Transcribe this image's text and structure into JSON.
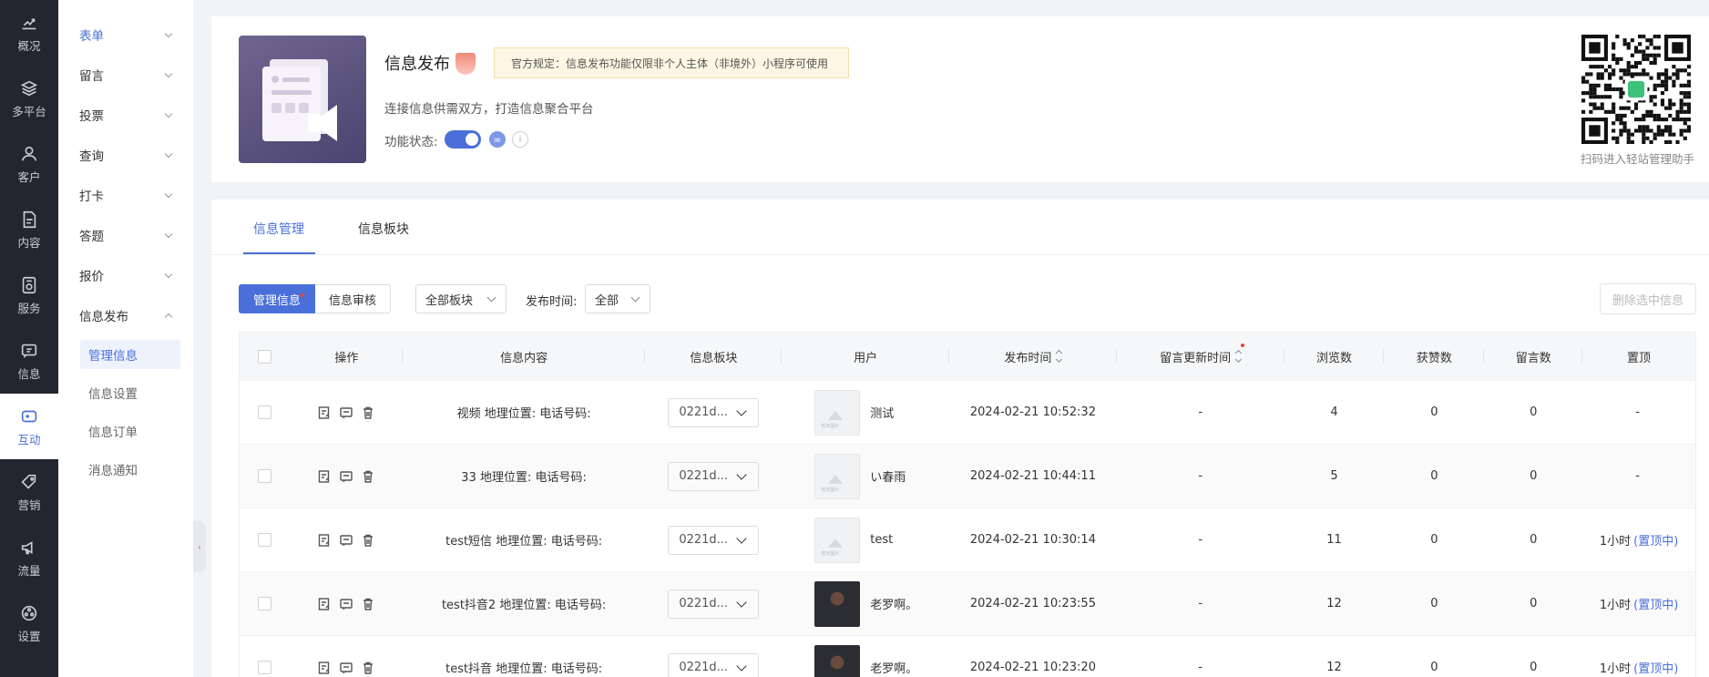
{
  "nav": [
    {
      "label": "概况",
      "icon": "chart-trend-icon"
    },
    {
      "label": "多平台",
      "icon": "layers-icon"
    },
    {
      "label": "客户",
      "icon": "user-icon"
    },
    {
      "label": "内容",
      "icon": "document-icon"
    },
    {
      "label": "服务",
      "icon": "service-icon"
    },
    {
      "label": "信息",
      "icon": "message-icon"
    },
    {
      "label": "互动",
      "icon": "gamepad-icon"
    },
    {
      "label": "营销",
      "icon": "tag-icon"
    },
    {
      "label": "流量",
      "icon": "megaphone-icon"
    },
    {
      "label": "设置",
      "icon": "settings-icon"
    }
  ],
  "submenu": {
    "groups": [
      "表单",
      "留言",
      "投票",
      "查询",
      "打卡",
      "答题",
      "报价"
    ],
    "open_group": "信息发布",
    "children": [
      "管理信息",
      "信息设置",
      "信息订单",
      "消息通知"
    ]
  },
  "header": {
    "title": "信息发布",
    "notice": "官方规定：信息发布功能仅限非个人主体（非境外）小程序可使用",
    "description": "连接信息供需双方，打造信息聚合平台",
    "status_label": "功能状态:",
    "status_on": true,
    "qr_caption": "扫码进入轻站管理助手"
  },
  "tabs": [
    "信息管理",
    "信息板块"
  ],
  "toolbar": {
    "manage_btn": "管理信息",
    "review_btn": "信息审核",
    "block_select": "全部板块",
    "time_label": "发布时间:",
    "time_select": "全部",
    "delete_btn": "删除选中信息"
  },
  "table": {
    "columns": [
      "操作",
      "信息内容",
      "信息板块",
      "用户",
      "发布时间",
      "留言更新时间",
      "浏览数",
      "获赞数",
      "留言数",
      "置顶"
    ],
    "rows": [
      {
        "content": "视频 地理位置: 电话号码:",
        "block": "0221d...",
        "user": "测试",
        "avatar": "placeholder",
        "time": "2024-02-21 10:52:32",
        "comment_time": "-",
        "views": "4",
        "likes": "0",
        "comments": "0",
        "pin": "-",
        "pin_link": ""
      },
      {
        "content": "33 地理位置: 电话号码:",
        "block": "0221d...",
        "user": "い春雨",
        "avatar": "placeholder",
        "time": "2024-02-21 10:44:11",
        "comment_time": "-",
        "views": "5",
        "likes": "0",
        "comments": "0",
        "pin": "-",
        "pin_link": ""
      },
      {
        "content": "test短信 地理位置: 电话号码:",
        "block": "0221d...",
        "user": "test",
        "avatar": "placeholder",
        "time": "2024-02-21 10:30:14",
        "comment_time": "-",
        "views": "11",
        "likes": "0",
        "comments": "0",
        "pin": "1小时",
        "pin_link": "(置顶中)"
      },
      {
        "content": "test抖音2 地理位置: 电话号码:",
        "block": "0221d...",
        "user": "老罗啊。",
        "avatar": "photo",
        "time": "2024-02-21 10:23:55",
        "comment_time": "-",
        "views": "12",
        "likes": "0",
        "comments": "0",
        "pin": "1小时",
        "pin_link": "(置顶中)"
      },
      {
        "content": "test抖音 地理位置: 电话号码:",
        "block": "0221d...",
        "user": "老罗啊。",
        "avatar": "photo",
        "time": "2024-02-21 10:23:20",
        "comment_time": "-",
        "views": "12",
        "likes": "0",
        "comments": "0",
        "pin": "1小时",
        "pin_link": "(置顶中)"
      }
    ]
  },
  "colors": {
    "accent": "#4a6fd8",
    "nav_bg": "#22262e"
  }
}
